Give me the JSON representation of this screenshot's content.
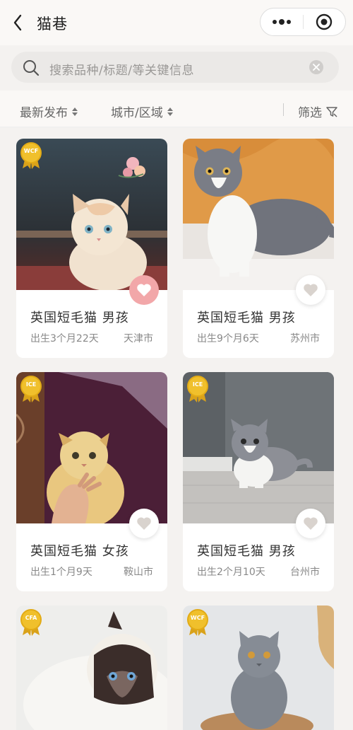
{
  "header": {
    "title": "猫巷"
  },
  "search": {
    "placeholder": "搜索品种/标题/等关键信息"
  },
  "filters": {
    "sort_label": "最新发布",
    "region_label": "城市/区域",
    "filter_label": "筛选"
  },
  "colors": {
    "page_bg": "#f4f2f0",
    "card_bg": "#ffffff",
    "heart_active": "#f2a7a9",
    "badge_gold": "#e9b724"
  },
  "listings": [
    {
      "badge": "WCF",
      "name": "英国短毛猫 男孩",
      "age": "出生3个月22天",
      "city": "天津市",
      "favorited": true
    },
    {
      "badge": "",
      "name": "英国短毛猫 男孩",
      "age": "出生9个月6天",
      "city": "苏州市",
      "favorited": false
    },
    {
      "badge": "ICE",
      "name": "英国短毛猫 女孩",
      "age": "出生1个月9天",
      "city": "鞍山市",
      "favorited": false
    },
    {
      "badge": "ICE",
      "name": "英国短毛猫 男孩",
      "age": "出生2个月10天",
      "city": "台州市",
      "favorited": false
    },
    {
      "badge": "CFA",
      "name": "",
      "age": "",
      "city": "",
      "favorited": false
    },
    {
      "badge": "WCF",
      "name": "",
      "age": "",
      "city": "",
      "favorited": false
    }
  ]
}
